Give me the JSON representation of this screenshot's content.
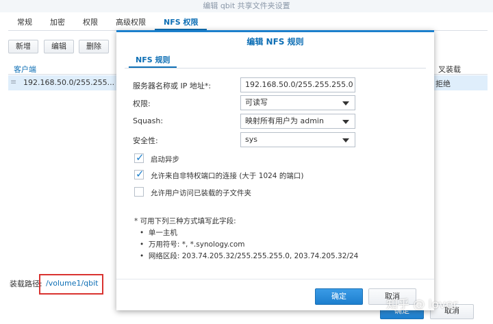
{
  "window": {
    "title": "编辑 qbit 共享文件夹设置"
  },
  "tabs": [
    "常规",
    "加密",
    "权限",
    "高级权限",
    "NFS 权限"
  ],
  "toolbar": {
    "add": "新增",
    "edit": "编辑",
    "delete": "删除"
  },
  "grid": {
    "headers": {
      "client": "客户端",
      "squash_partial": "叉装载"
    },
    "row": {
      "client": "192.168.50.0/255.255...",
      "squash_partial": "拒绝"
    }
  },
  "mount": {
    "label": "装载路径:",
    "value": "/volume1/qbit"
  },
  "footer": {
    "ok": "确定",
    "cancel": "取消"
  },
  "modal": {
    "title": "编辑 NFS 规则",
    "tab": "NFS 规则",
    "fields": {
      "host_label": "服务器名称或 IP 地址*:",
      "host_value": "192.168.50.0/255.255.255.0",
      "privilege_label": "权限:",
      "privilege_value": "可读写",
      "squash_label": "Squash:",
      "squash_value": "映射所有用户为 admin",
      "security_label": "安全性:",
      "security_value": "sys"
    },
    "checkboxes": [
      {
        "label": "启动异步",
        "checked": true
      },
      {
        "label": "允许来自非特权端口的连接 (大于 1024 的端口)",
        "checked": true
      },
      {
        "label": "允许用户访问已装载的子文件夹",
        "checked": false
      }
    ],
    "note": "* 可用下列三种方式填写此字段:",
    "bullets": [
      "单一主机",
      "万用符号: *, *.synology.com",
      "网络区段: 203.74.205.32/255.255.255.0, 203.74.205.32/24"
    ],
    "ok": "确定",
    "cancel": "取消"
  },
  "watermark": "知乎 @ lover",
  "colors": {
    "accent": "#0e6fb5",
    "selected_row": "#dfeefb",
    "highlight_border": "#d9322f"
  }
}
